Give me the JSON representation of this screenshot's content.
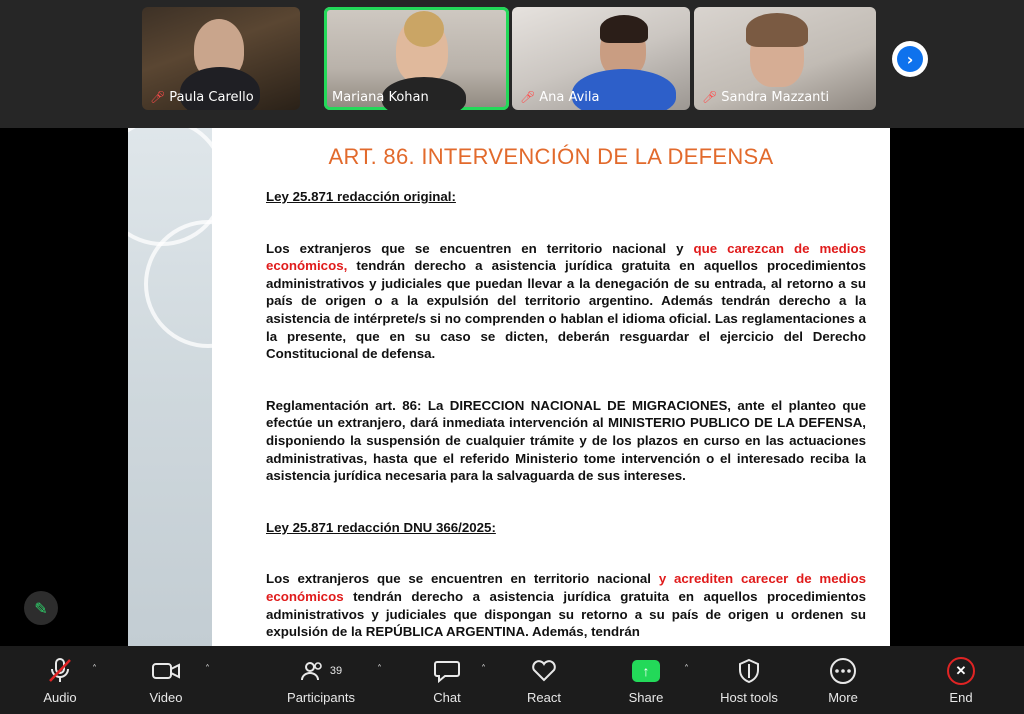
{
  "participants_gallery": [
    {
      "name": "Paula Carello",
      "muted": true
    },
    {
      "name": "Mariana Kohan",
      "muted": false,
      "active": true
    },
    {
      "name": "Ana Avila",
      "muted": true
    },
    {
      "name": "Sandra Mazzanti",
      "muted": true
    }
  ],
  "slide": {
    "title": "ART. 86. INTERVENCIÓN DE LA DEFENSA",
    "h1": "Ley 25.871 redacción original:",
    "p1_a": "Los extranjeros que se encuentren en territorio nacional y ",
    "p1_red": "que carezcan de medios económicos,",
    "p1_b": " tendrán derecho a asistencia jurídica gratuita en aquellos procedimientos administrativos y judiciales que puedan llevar a la denegación de su entrada, al retorno a su país de origen o a la expulsión del territorio argentino. Además tendrán derecho a la asistencia de intérprete/s si no comprenden o hablan el idioma oficial. Las reglamentaciones a la presente, que en su caso se dicten, deberán resguardar el ejercicio del Derecho Constitucional de defensa.",
    "p2": "Reglamentación art. 86: La DIRECCION NACIONAL DE MIGRACIONES, ante el planteo que efectúe un extranjero, dará inmediata intervención al MINISTERIO PUBLICO DE LA DEFENSA, disponiendo la suspensión de cualquier trámite y de los plazos en curso en las actuaciones administrativas, hasta que el referido Ministerio tome intervención o el interesado reciba la asistencia jurídica necesaria para la salvaguarda de sus intereses.",
    "h2": "Ley 25.871 redacción DNU 366/2025:",
    "p3_a": "Los extranjeros que se encuentren en territorio nacional ",
    "p3_red": "y acrediten carecer de medios económicos",
    "p3_b": " tendrán derecho a asistencia jurídica gratuita en aquellos procedimientos administrativos y judiciales que dispongan su retorno a su país de origen u ordenen su expulsión de la REPÚBLICA ARGENTINA. Además, tendrán"
  },
  "toolbar": {
    "audio": "Audio",
    "video": "Video",
    "participants": "Participants",
    "participants_count": "39",
    "chat": "Chat",
    "react": "React",
    "share": "Share",
    "host_tools": "Host tools",
    "more": "More",
    "end": "End"
  },
  "colors": {
    "accent_green": "#23d959",
    "title_orange": "#e26a2c",
    "highlight_red": "#e01b1b",
    "end_red": "#e02424"
  }
}
